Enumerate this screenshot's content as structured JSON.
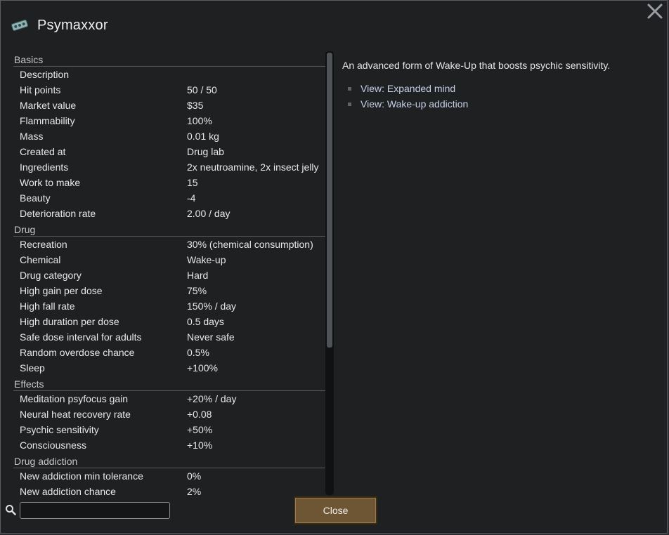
{
  "window": {
    "title": "Psymaxxor",
    "title_icon": "drug-pills-icon",
    "close_icon": "close-x-icon"
  },
  "stats": {
    "sections": [
      {
        "header": "Basics",
        "rows": [
          {
            "label": "Description",
            "value": ""
          },
          {
            "label": "Hit points",
            "value": "50 / 50"
          },
          {
            "label": "Market value",
            "value": "$35"
          },
          {
            "label": "Flammability",
            "value": "100%"
          },
          {
            "label": "Mass",
            "value": "0.01 kg"
          },
          {
            "label": "Created at",
            "value": "Drug lab"
          },
          {
            "label": "Ingredients",
            "value": "2x neutroamine, 2x insect jelly"
          },
          {
            "label": "Work to make",
            "value": "15"
          },
          {
            "label": "Beauty",
            "value": "-4"
          },
          {
            "label": "Deterioration rate",
            "value": "2.00 / day"
          }
        ]
      },
      {
        "header": "Drug",
        "rows": [
          {
            "label": "Recreation",
            "value": "30% (chemical consumption)"
          },
          {
            "label": "Chemical",
            "value": "Wake-up"
          },
          {
            "label": "Drug category",
            "value": "Hard"
          },
          {
            "label": "High gain per dose",
            "value": "75%"
          },
          {
            "label": "High fall rate",
            "value": "150% / day"
          },
          {
            "label": "High duration per dose",
            "value": "0.5 days"
          },
          {
            "label": "Safe dose interval for adults",
            "value": "Never safe"
          },
          {
            "label": "Random overdose chance",
            "value": "0.5%"
          },
          {
            "label": "Sleep",
            "value": "+100%"
          }
        ]
      },
      {
        "header": "Effects",
        "rows": [
          {
            "label": "Meditation psyfocus gain",
            "value": "+20% / day"
          },
          {
            "label": "Neural heat recovery rate",
            "value": "+0.08"
          },
          {
            "label": "Psychic sensitivity",
            "value": "+50%"
          },
          {
            "label": "Consciousness",
            "value": "+10%"
          }
        ]
      },
      {
        "header": "Drug addiction",
        "rows": [
          {
            "label": "New addiction min tolerance",
            "value": "0%"
          },
          {
            "label": "New addiction chance",
            "value": "2%"
          }
        ]
      }
    ]
  },
  "description": {
    "text": "An advanced form of Wake-Up that boosts psychic sensitivity.",
    "links": [
      {
        "label": "View: Expanded mind"
      },
      {
        "label": "View: Wake-up addiction"
      }
    ]
  },
  "footer": {
    "search_value": "",
    "search_icon": "search-icon",
    "close_label": "Close"
  },
  "colors": {
    "window_bg": "#1e2022",
    "button_bg": "#6e5534",
    "link": "#c6d0e6"
  }
}
